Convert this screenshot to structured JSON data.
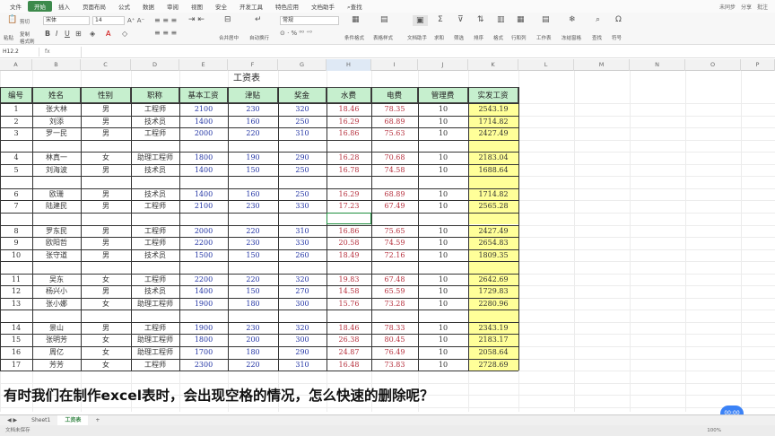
{
  "menu": {
    "items": [
      "文件",
      "开始",
      "插入",
      "页面布局",
      "公式",
      "数据",
      "审阅",
      "视图",
      "安全",
      "开发工具",
      "特色应用",
      "文档助手"
    ],
    "active_index": 1,
    "search_label": "查找",
    "right": [
      "未同步",
      "分享",
      "批注"
    ]
  },
  "toolbar": {
    "paste": "粘贴",
    "cut": "剪切",
    "copy": "复制",
    "format_painter": "格式刷",
    "font_name": "宋体",
    "font_size": "14",
    "merge_center": "合并居中",
    "wrap": "自动换行",
    "number_format": "常规",
    "conditional_format": "条件格式",
    "table_style": "表格样式",
    "doc_assistant": "文档助手",
    "sum": "求和",
    "filter": "筛选",
    "sort": "排序",
    "format": "格式",
    "row_col": "行和列",
    "worksheet": "工作表",
    "freeze": "冻结窗格",
    "find": "查找",
    "symbol": "符号"
  },
  "formula_bar": {
    "name_box": "H12.2",
    "fx": "fx",
    "content": ""
  },
  "columns": [
    "A",
    "B",
    "C",
    "D",
    "E",
    "F",
    "G",
    "H",
    "I",
    "J",
    "K",
    "L",
    "M",
    "N",
    "O",
    "P"
  ],
  "selected_column": "H",
  "table": {
    "title": "工资表",
    "headers": [
      "编号",
      "姓名",
      "性别",
      "职称",
      "基本工资",
      "津贴",
      "奖金",
      "水费",
      "电费",
      "管理费",
      "实发工资"
    ],
    "rows": [
      [
        "1",
        "张大林",
        "男",
        "工程师",
        "2100",
        "230",
        "320",
        "18.46",
        "78.35",
        "10",
        "2543.19"
      ],
      [
        "2",
        "刘添",
        "男",
        "技术员",
        "1400",
        "160",
        "250",
        "16.29",
        "68.89",
        "10",
        "1714.82"
      ],
      [
        "3",
        "罗一民",
        "男",
        "工程师",
        "2000",
        "220",
        "310",
        "16.86",
        "75.63",
        "10",
        "2427.49"
      ],
      null,
      [
        "4",
        "林真一",
        "女",
        "助理工程师",
        "1800",
        "190",
        "290",
        "16.28",
        "70.68",
        "10",
        "2183.04"
      ],
      [
        "5",
        "刘海波",
        "男",
        "技术员",
        "1400",
        "150",
        "250",
        "16.78",
        "74.58",
        "10",
        "1688.64"
      ],
      null,
      [
        "6",
        "欧珊",
        "男",
        "技术员",
        "1400",
        "160",
        "250",
        "16.29",
        "68.89",
        "10",
        "1714.82"
      ],
      [
        "7",
        "陆建民",
        "男",
        "工程师",
        "2100",
        "230",
        "330",
        "17.23",
        "67.49",
        "10",
        "2565.28"
      ],
      null,
      [
        "8",
        "罗东民",
        "男",
        "工程师",
        "2000",
        "220",
        "310",
        "16.86",
        "75.65",
        "10",
        "2427.49"
      ],
      [
        "9",
        "欧阳哲",
        "男",
        "工程师",
        "2200",
        "230",
        "330",
        "20.58",
        "74.59",
        "10",
        "2654.83"
      ],
      [
        "10",
        "张守道",
        "男",
        "技术员",
        "1500",
        "150",
        "260",
        "18.49",
        "72.16",
        "10",
        "1809.35"
      ],
      null,
      [
        "11",
        "吴东",
        "女",
        "工程师",
        "2200",
        "220",
        "320",
        "19.83",
        "67.48",
        "10",
        "2642.69"
      ],
      [
        "12",
        "杨兴小",
        "男",
        "技术员",
        "1400",
        "150",
        "270",
        "14.58",
        "65.59",
        "10",
        "1729.83"
      ],
      [
        "13",
        "张小娜",
        "女",
        "助理工程师",
        "1900",
        "180",
        "300",
        "15.76",
        "73.28",
        "10",
        "2280.96"
      ],
      null,
      [
        "14",
        "景山",
        "男",
        "工程师",
        "1900",
        "230",
        "320",
        "18.46",
        "78.33",
        "10",
        "2343.19"
      ],
      [
        "15",
        "张明芳",
        "女",
        "助理工程师",
        "1800",
        "200",
        "300",
        "26.38",
        "80.45",
        "10",
        "2183.17"
      ],
      [
        "16",
        "周亿",
        "女",
        "助理工程师",
        "1700",
        "180",
        "290",
        "24.87",
        "76.49",
        "10",
        "2058.64"
      ],
      [
        "17",
        "芳芳",
        "女",
        "工程师",
        "2300",
        "220",
        "310",
        "16.48",
        "73.83",
        "10",
        "2728.69"
      ]
    ]
  },
  "subtitle": "有时我们在制作excel表时，会出现空格的情况，怎么快速的删除呢？",
  "sheets": [
    "Sheet1",
    "工资表"
  ],
  "active_sheet_index": 1,
  "status": {
    "left": "文档未保存",
    "zoom": "100%"
  },
  "timer": "00:00",
  "colors": {
    "accent": "#3d8a4c",
    "header_fill": "#c6efce",
    "total_fill": "#ffff99",
    "blue_text": "#2436a5",
    "red_text": "#b7323f"
  }
}
